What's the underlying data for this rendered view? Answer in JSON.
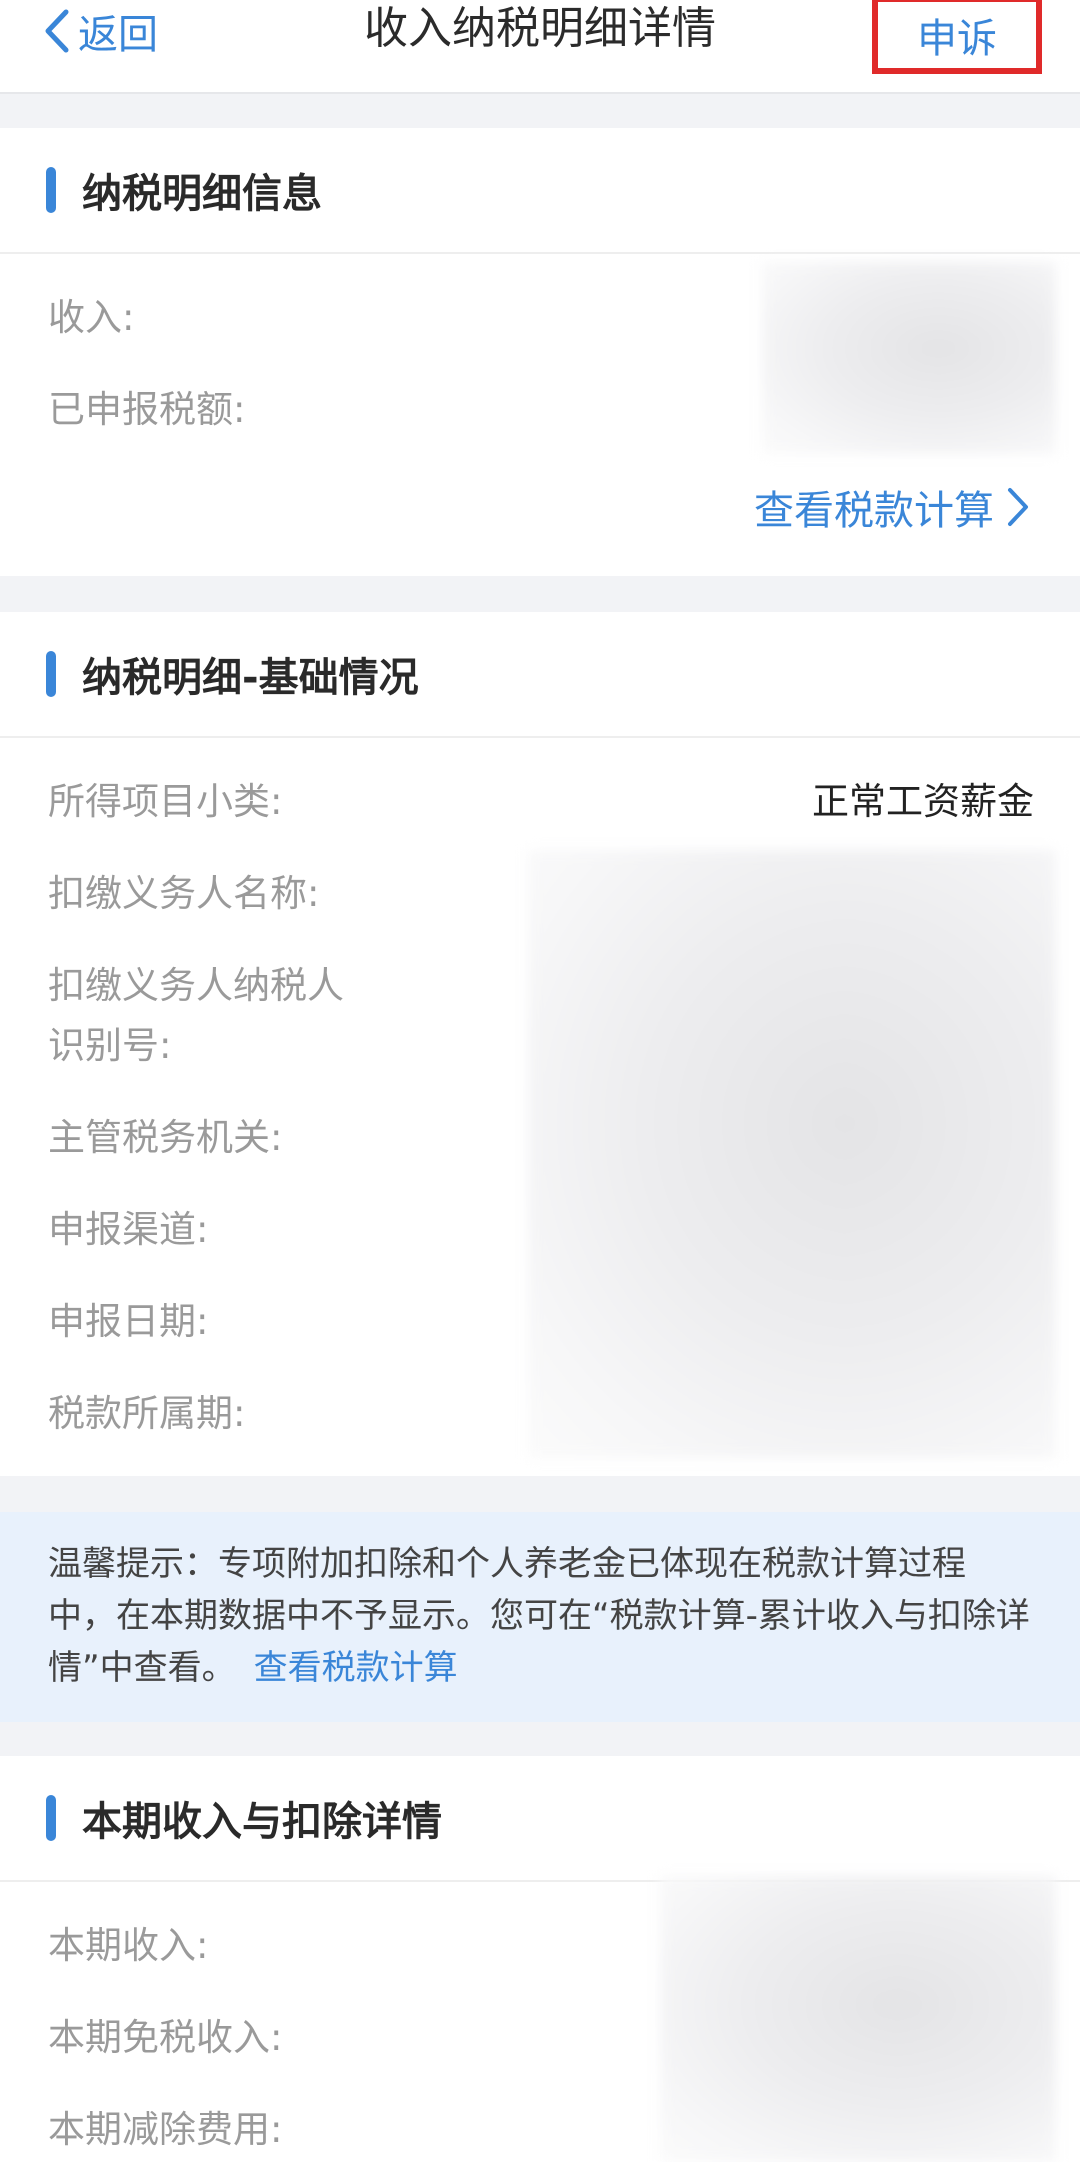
{
  "nav": {
    "back_label": "返回",
    "title": "收入纳税明细详情",
    "appeal_label": "申诉"
  },
  "section1": {
    "title": "纳税明细信息",
    "rows": [
      {
        "label": "收入:"
      },
      {
        "label": "已申报税额:"
      }
    ],
    "link_label": "查看税款计算"
  },
  "section2": {
    "title": "纳税明细-基础情况",
    "rows": [
      {
        "label": "所得项目小类:",
        "value": "正常工资薪金"
      },
      {
        "label": "扣缴义务人名称:"
      },
      {
        "label_line1": "扣缴义务人纳税人",
        "label_line2": "识别号:"
      },
      {
        "label": "主管税务机关:"
      },
      {
        "label": "申报渠道:"
      },
      {
        "label": "申报日期:"
      },
      {
        "label": "税款所属期:"
      }
    ]
  },
  "tip": {
    "text": "温馨提示：专项附加扣除和个人养老金已体现在税款计算过程中，在本期数据中不予显示。您可在“税款计算-累计收入与扣除详情”中查看。",
    "link_label": "查看税款计算"
  },
  "section3": {
    "title": "本期收入与扣除详情",
    "rows": [
      {
        "label": "本期收入:"
      },
      {
        "label": "本期免税收入:"
      },
      {
        "label": "本期减除费用:"
      }
    ]
  },
  "colors": {
    "accent": "#3a86d8",
    "highlight_box": "#e02a2a",
    "tip_background": "#e8f1fc"
  }
}
